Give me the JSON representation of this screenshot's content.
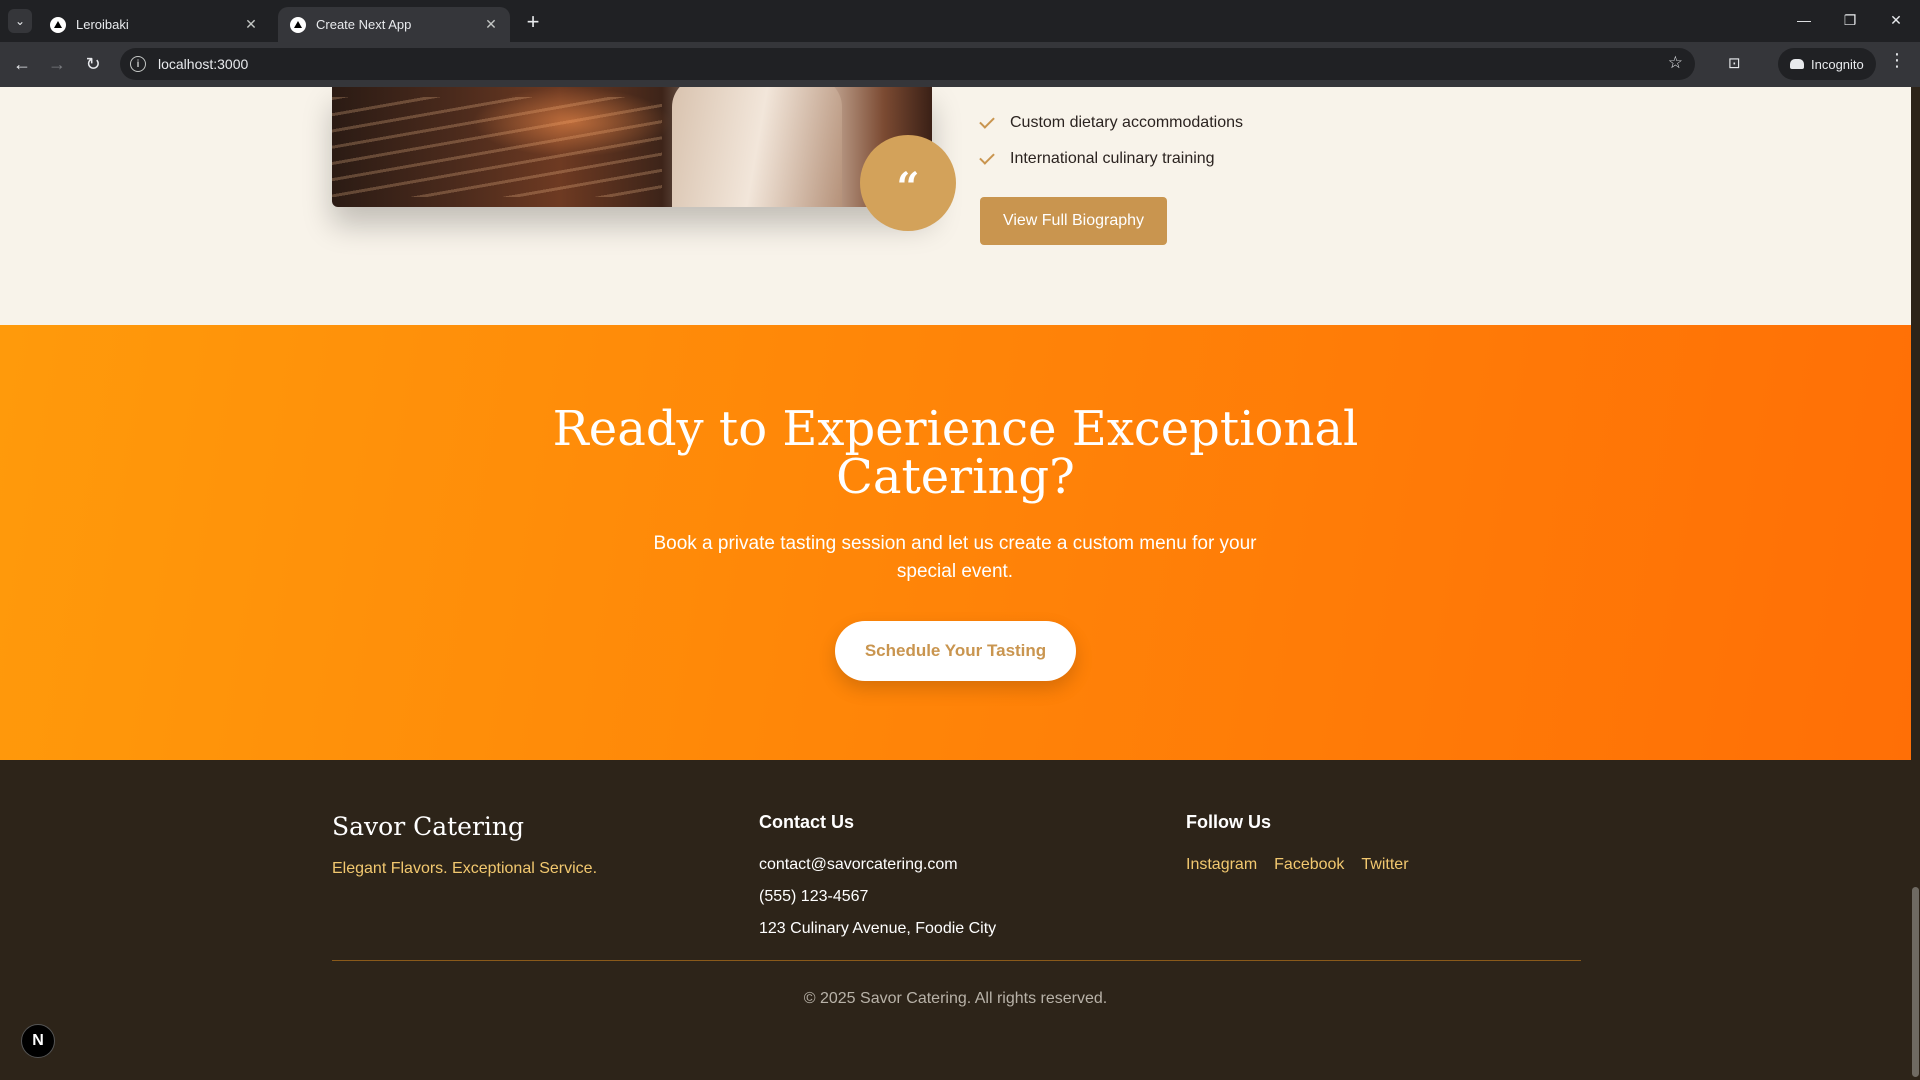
{
  "browser": {
    "tabs": [
      {
        "title": "Leroibaki",
        "active": false
      },
      {
        "title": "Create Next App",
        "active": true
      }
    ],
    "url": "localhost:3000",
    "incognito_label": "Incognito"
  },
  "chef": {
    "features": [
      "Custom dietary accommodations",
      "International culinary training"
    ],
    "quote_glyph": "“",
    "bio_button": "View Full Biography"
  },
  "cta": {
    "title_line1": "Ready to Experience Exceptional",
    "title_line2": "Catering?",
    "subtitle": "Book a private tasting session and let us create a custom menu for your special event.",
    "button": "Schedule Your Tasting"
  },
  "footer": {
    "brand": "Savor Catering",
    "tagline": "Elegant Flavors. Exceptional Service.",
    "contact_heading": "Contact Us",
    "email": "contact@savorcatering.com",
    "phone": "(555) 123-4567",
    "address": "123 Culinary Avenue, Foodie City",
    "follow_heading": "Follow Us",
    "social": [
      "Instagram",
      "Facebook",
      "Twitter"
    ],
    "copyright": "© 2025 Savor Catering. All rights reserved."
  },
  "dev_badge": "N",
  "colors": {
    "accent_gold": "#c9954f",
    "cta_orange_start": "#ff9a0b",
    "cta_orange_end": "#ff6f06",
    "footer_bg": "#2d2419",
    "page_bg": "#f8f3ea",
    "link_yellow": "#f2c86f"
  }
}
